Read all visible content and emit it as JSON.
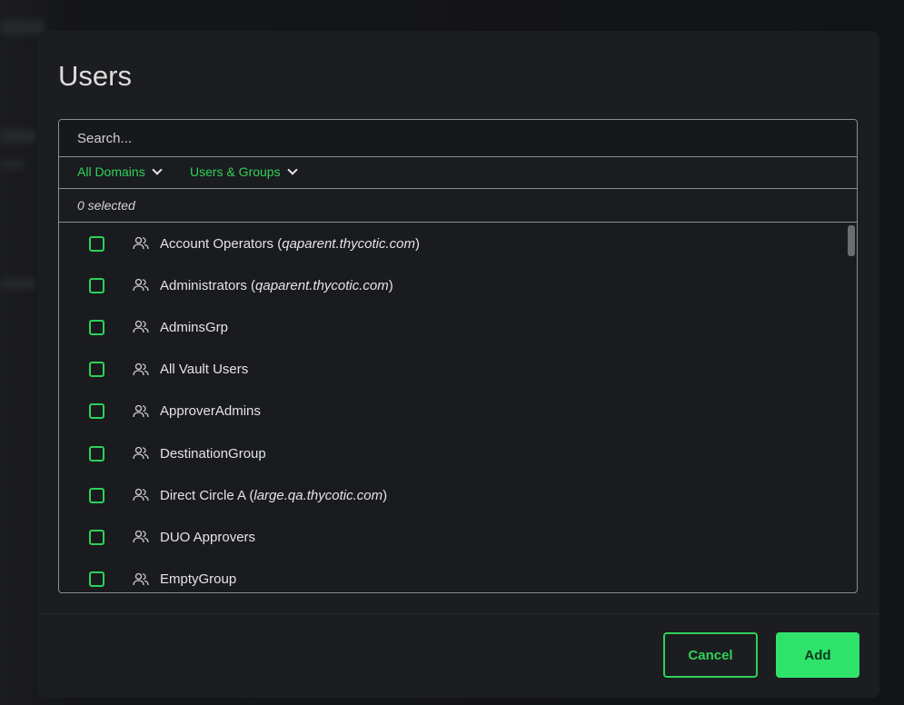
{
  "dialog": {
    "title": "Users"
  },
  "search": {
    "placeholder": "Search..."
  },
  "filters": {
    "domain_label": "All Domains",
    "type_label": "Users & Groups"
  },
  "selection": {
    "count_text": "0 selected"
  },
  "list": {
    "items": [
      {
        "name": "Account Operators",
        "domain": "qaparent.thycotic.com",
        "checked": false
      },
      {
        "name": "Administrators",
        "domain": "qaparent.thycotic.com",
        "checked": false
      },
      {
        "name": "AdminsGrp",
        "domain": "",
        "checked": false
      },
      {
        "name": "All Vault Users",
        "domain": "",
        "checked": false
      },
      {
        "name": "ApproverAdmins",
        "domain": "",
        "checked": false
      },
      {
        "name": "DestinationGroup",
        "domain": "",
        "checked": false
      },
      {
        "name": "Direct Circle A",
        "domain": "large.qa.thycotic.com",
        "checked": false
      },
      {
        "name": "DUO Approvers",
        "domain": "",
        "checked": false
      },
      {
        "name": "EmptyGroup",
        "domain": "",
        "checked": false
      }
    ],
    "item_icon": "group-icon"
  },
  "buttons": {
    "cancel_label": "Cancel",
    "add_label": "Add"
  },
  "colors": {
    "accent": "#2fd15a",
    "add_button": "#2fe36a",
    "dialog_bg": "#1c1d20",
    "text": "#e4e4e4"
  }
}
